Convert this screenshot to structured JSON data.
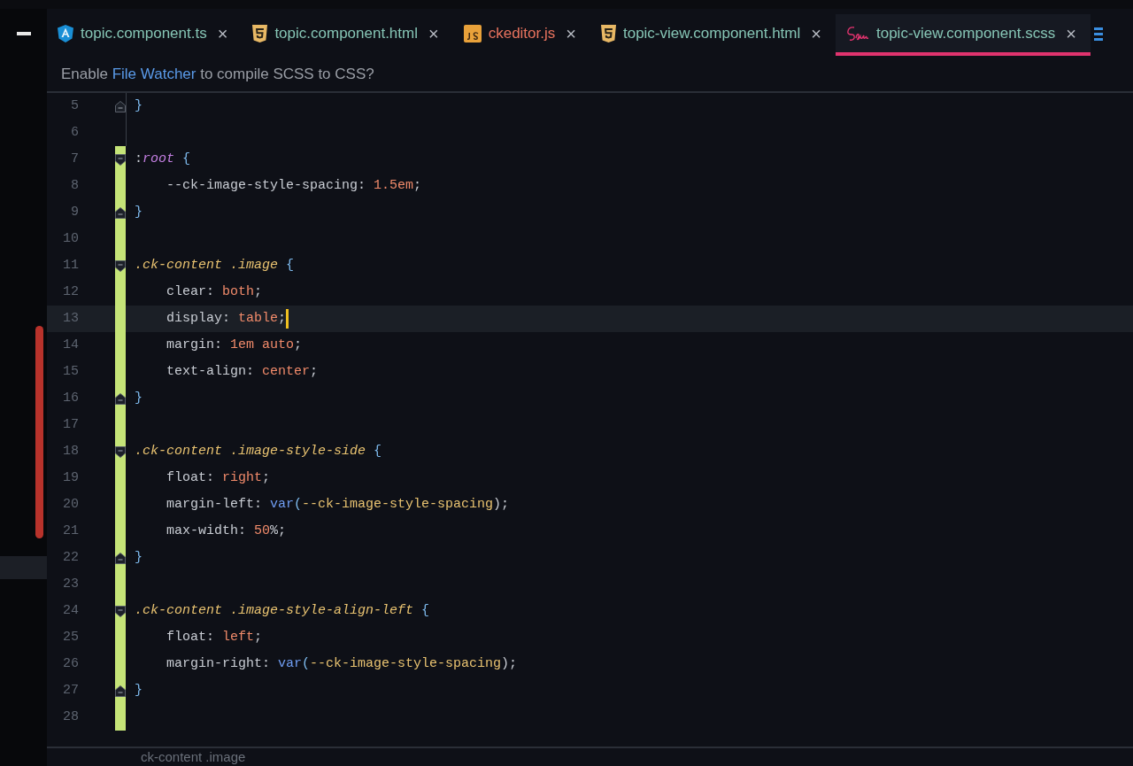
{
  "tabs": [
    {
      "label": "topic.component.ts",
      "kind": "angular",
      "color": "#86c5b5",
      "selected": false,
      "close": "×"
    },
    {
      "label": "topic.component.html",
      "kind": "html5",
      "color": "#86c5b5",
      "selected": false,
      "close": "×"
    },
    {
      "label": "ckeditor.js",
      "kind": "js",
      "color": "#e8735e",
      "selected": false,
      "close": "×"
    },
    {
      "label": "topic-view.component.html",
      "kind": "html5",
      "color": "#86c5b5",
      "selected": false,
      "close": "×"
    },
    {
      "label": "topic-view.component.scss",
      "kind": "sass",
      "color": "#86c5b5",
      "selected": true,
      "close": "×"
    }
  ],
  "banner": {
    "before": "Enable ",
    "link": "File Watcher",
    "after": " to compile SCSS to CSS?"
  },
  "lines": [
    {
      "num": "5",
      "kind": "close",
      "changed": false,
      "selected": false,
      "tokens": [
        {
          "t": "}",
          "kind": "brace"
        }
      ]
    },
    {
      "num": "6",
      "kind": "plain",
      "changed": false,
      "selected": false
    },
    {
      "num": "7",
      "kind": "open",
      "changed": true,
      "selected": false,
      "tokens": [
        {
          "t": ":",
          "kind": "punct"
        },
        {
          "t": "root",
          "kind": "pseudo"
        },
        {
          "t": " {",
          "kind": "brace"
        }
      ]
    },
    {
      "num": "8",
      "kind": "plain",
      "changed": true,
      "selected": false,
      "tokens": [
        {
          "t": "    --ck-image-style-spacing: ",
          "kind": "prop"
        },
        {
          "t": "1.5em",
          "kind": "value"
        },
        {
          "t": ";",
          "kind": "punct"
        }
      ]
    },
    {
      "num": "9",
      "kind": "close",
      "changed": true,
      "selected": false,
      "tokens": [
        {
          "t": "}",
          "kind": "brace"
        }
      ]
    },
    {
      "num": "10",
      "kind": "plain",
      "changed": true,
      "selected": false
    },
    {
      "num": "11",
      "kind": "open",
      "changed": true,
      "selected": false,
      "tokens": [
        {
          "t": ".ck-content .image",
          "kind": "selector"
        },
        {
          "t": " {",
          "kind": "brace"
        }
      ]
    },
    {
      "num": "12",
      "kind": "plain",
      "changed": true,
      "selected": false,
      "tokens": [
        {
          "t": "    clear: ",
          "kind": "prop"
        },
        {
          "t": "both",
          "kind": "value"
        },
        {
          "t": ";",
          "kind": "punct"
        }
      ]
    },
    {
      "num": "13",
      "kind": "plain",
      "changed": true,
      "selected": true,
      "tokens": [
        {
          "t": "    display: ",
          "kind": "prop"
        },
        {
          "t": "table",
          "kind": "value"
        },
        {
          "t": ";",
          "kind": "punct"
        }
      ]
    },
    {
      "num": "14",
      "kind": "plain",
      "changed": true,
      "selected": false,
      "tokens": [
        {
          "t": "    margin: ",
          "kind": "prop"
        },
        {
          "t": "1em auto",
          "kind": "value"
        },
        {
          "t": ";",
          "kind": "punct"
        }
      ]
    },
    {
      "num": "15",
      "kind": "plain",
      "changed": true,
      "selected": false,
      "tokens": [
        {
          "t": "    text-align: ",
          "kind": "prop"
        },
        {
          "t": "center",
          "kind": "value"
        },
        {
          "t": ";",
          "kind": "punct"
        }
      ]
    },
    {
      "num": "16",
      "kind": "close",
      "changed": true,
      "selected": false,
      "tokens": [
        {
          "t": "}",
          "kind": "brace"
        }
      ]
    },
    {
      "num": "17",
      "kind": "plain",
      "changed": true,
      "selected": false
    },
    {
      "num": "18",
      "kind": "open",
      "changed": true,
      "selected": false,
      "tokens": [
        {
          "t": ".ck-content .image-style-side",
          "kind": "selector"
        },
        {
          "t": " {",
          "kind": "brace"
        }
      ]
    },
    {
      "num": "19",
      "kind": "plain",
      "changed": true,
      "selected": false,
      "tokens": [
        {
          "t": "    float: ",
          "kind": "prop"
        },
        {
          "t": "right",
          "kind": "value"
        },
        {
          "t": ";",
          "kind": "punct"
        }
      ]
    },
    {
      "num": "20",
      "kind": "plain",
      "changed": true,
      "selected": false,
      "tokens": [
        {
          "t": "    margin-left: ",
          "kind": "prop"
        },
        {
          "t": "var",
          "kind": "func"
        },
        {
          "t": "(",
          "kind": "brace"
        },
        {
          "t": "--ck-image-style-spacing",
          "kind": "variable"
        },
        {
          "t": ");",
          "kind": "punct"
        }
      ]
    },
    {
      "num": "21",
      "kind": "plain",
      "changed": true,
      "selected": false,
      "tokens": [
        {
          "t": "    max-width: ",
          "kind": "prop"
        },
        {
          "t": "50",
          "kind": "value"
        },
        {
          "t": "%;",
          "kind": "punct"
        }
      ]
    },
    {
      "num": "22",
      "kind": "close",
      "changed": true,
      "selected": false,
      "tokens": [
        {
          "t": "}",
          "kind": "brace"
        }
      ]
    },
    {
      "num": "23",
      "kind": "plain",
      "changed": true,
      "selected": false
    },
    {
      "num": "24",
      "kind": "open",
      "changed": true,
      "selected": false,
      "tokens": [
        {
          "t": ".ck-content .image-style-align-left",
          "kind": "selector"
        },
        {
          "t": " {",
          "kind": "brace"
        }
      ]
    },
    {
      "num": "25",
      "kind": "plain",
      "changed": true,
      "selected": false,
      "tokens": [
        {
          "t": "    float: ",
          "kind": "prop"
        },
        {
          "t": "left",
          "kind": "value"
        },
        {
          "t": ";",
          "kind": "punct"
        }
      ]
    },
    {
      "num": "26",
      "kind": "plain",
      "changed": true,
      "selected": false,
      "tokens": [
        {
          "t": "    margin-right: ",
          "kind": "prop"
        },
        {
          "t": "var",
          "kind": "func"
        },
        {
          "t": "(",
          "kind": "brace"
        },
        {
          "t": "--ck-image-style-spacing",
          "kind": "variable"
        },
        {
          "t": ");",
          "kind": "punct"
        }
      ]
    },
    {
      "num": "27",
      "kind": "close",
      "changed": true,
      "selected": false,
      "tokens": [
        {
          "t": "}",
          "kind": "brace"
        }
      ]
    },
    {
      "num": "28",
      "kind": "plain",
      "changed": true,
      "selected": false
    }
  ],
  "breadcrumb": "ck-content .image"
}
